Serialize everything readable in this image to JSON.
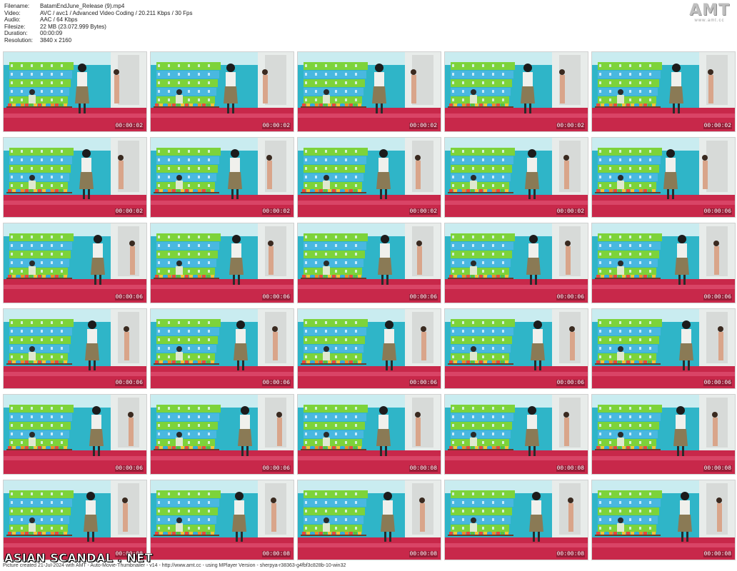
{
  "info": {
    "rows": [
      {
        "key": "Filename:",
        "value": "BatamEndJune_Release (9).mp4"
      },
      {
        "key": "Video:",
        "value": "AVC / avc1 / Advanced Video Coding / 20.211 Kbps / 30 Fps"
      },
      {
        "key": "Audio:",
        "value": "AAC / 64 Kbps"
      },
      {
        "key": "Filesize:",
        "value": "22 MB (23.072.999 Bytes)"
      },
      {
        "key": "Duration:",
        "value": "00:00:09"
      },
      {
        "key": "Resolution:",
        "value": "3840 x 2160"
      }
    ]
  },
  "logo": {
    "text": "AMT",
    "sub": "www.amt.cc"
  },
  "thumbnails": [
    {
      "time": "00:00:02"
    },
    {
      "time": "00:00:02"
    },
    {
      "time": "00:00:02"
    },
    {
      "time": "00:00:02"
    },
    {
      "time": "00:00:02"
    },
    {
      "time": "00:00:02"
    },
    {
      "time": "00:00:02"
    },
    {
      "time": "00:00:02"
    },
    {
      "time": "00:00:02"
    },
    {
      "time": "00:00:06"
    },
    {
      "time": "00:00:06"
    },
    {
      "time": "00:00:06"
    },
    {
      "time": "00:00:06"
    },
    {
      "time": "00:00:06"
    },
    {
      "time": "00:00:06"
    },
    {
      "time": "00:00:06"
    },
    {
      "time": "00:00:06"
    },
    {
      "time": "00:00:06"
    },
    {
      "time": "00:00:06"
    },
    {
      "time": "00:00:06"
    },
    {
      "time": "00:00:06"
    },
    {
      "time": "00:00:06"
    },
    {
      "time": "00:00:08"
    },
    {
      "time": "00:00:08"
    },
    {
      "time": "00:00:08"
    },
    {
      "time": "00:00:08"
    },
    {
      "time": "00:00:08"
    },
    {
      "time": "00:00:08"
    },
    {
      "time": "00:00:08"
    },
    {
      "time": "00:00:08"
    }
  ],
  "watermark": "ASIAN SCANDAL . NET",
  "footer": "Picture created 21-Jul-2024 with AMT - Auto-Movie-Thumbnailer - v14 - http://www.amt.cc - using MPlayer Version - sherpya-r38363-g4fbf3c828b-10-win32"
}
